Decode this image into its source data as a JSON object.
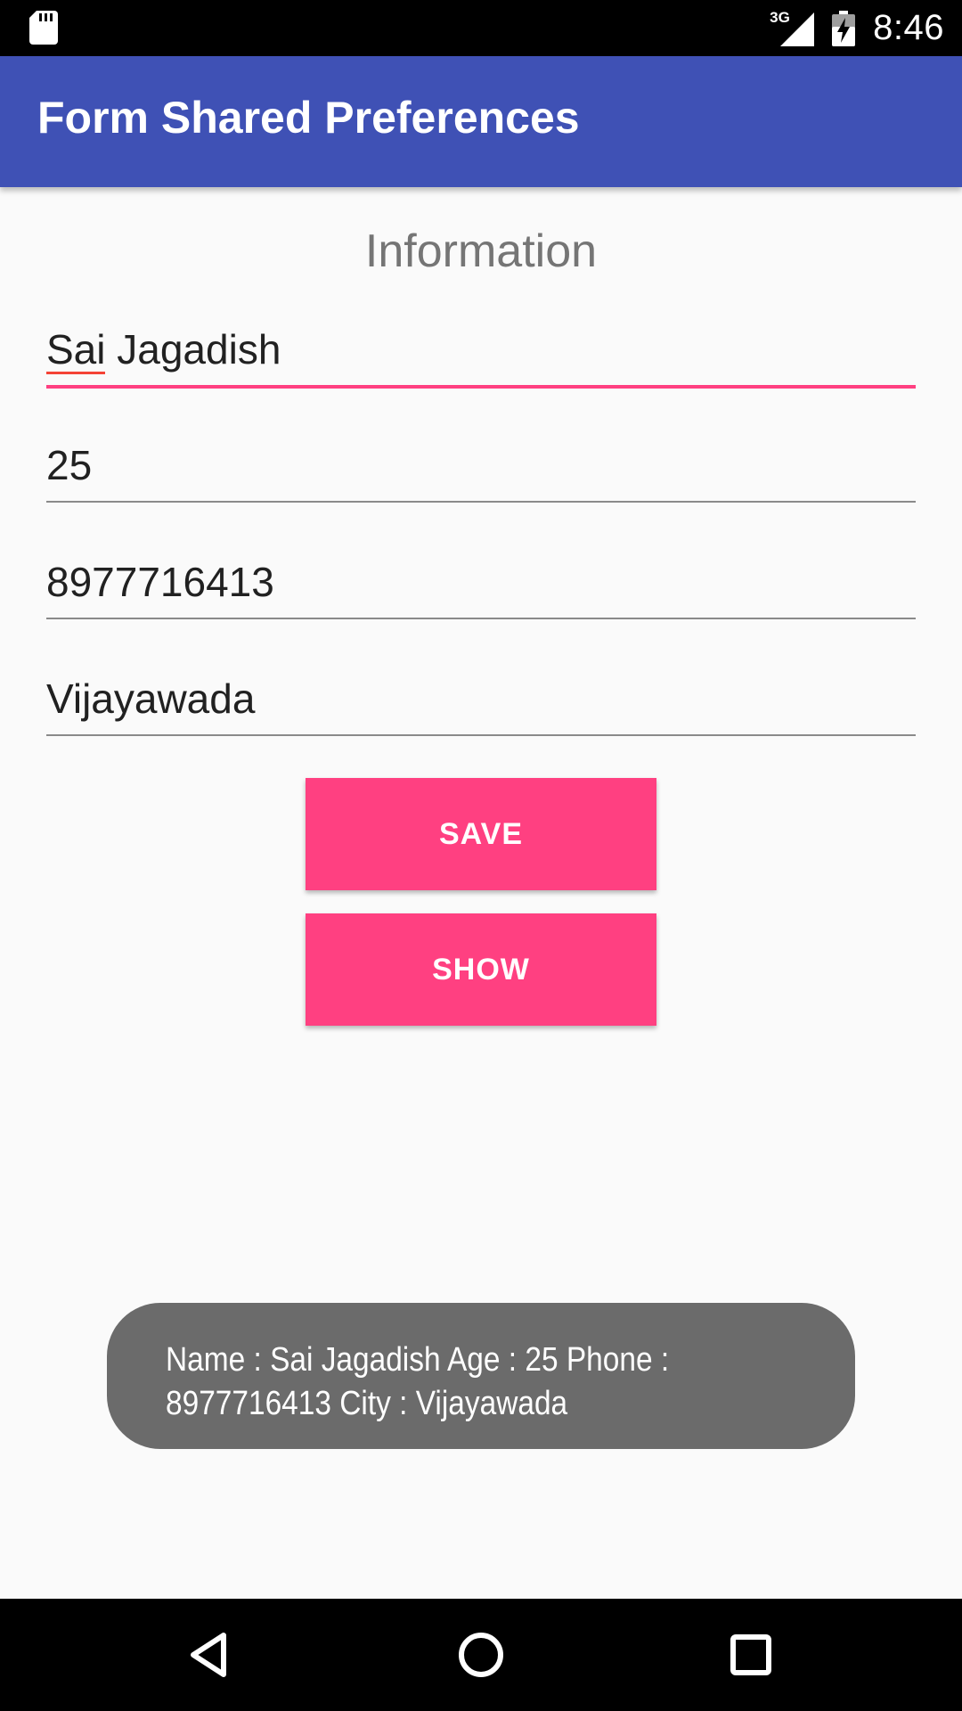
{
  "status_bar": {
    "time": "8:46",
    "network": "3G",
    "icons": [
      "sd-card-icon",
      "signal-3g-icon",
      "battery-charging-icon"
    ]
  },
  "app_bar": {
    "title": "Form Shared Preferences",
    "color": "#3f51b5"
  },
  "form": {
    "heading": "Information",
    "fields": [
      {
        "name": "name",
        "value": "Sai Jagadish"
      },
      {
        "name": "age",
        "value": "25"
      },
      {
        "name": "phone",
        "value": "8977716413"
      },
      {
        "name": "city",
        "value": "Vijayawada"
      }
    ],
    "accent_color": "#ff4081"
  },
  "buttons": {
    "save_label": "SAVE",
    "show_label": "SHOW"
  },
  "toast": {
    "message": "Name : Sai Jagadish Age : 25 Phone : 8977716413 City : Vijayawada"
  },
  "nav_bar": {
    "icons": [
      "back-icon",
      "home-icon",
      "recents-icon"
    ]
  }
}
